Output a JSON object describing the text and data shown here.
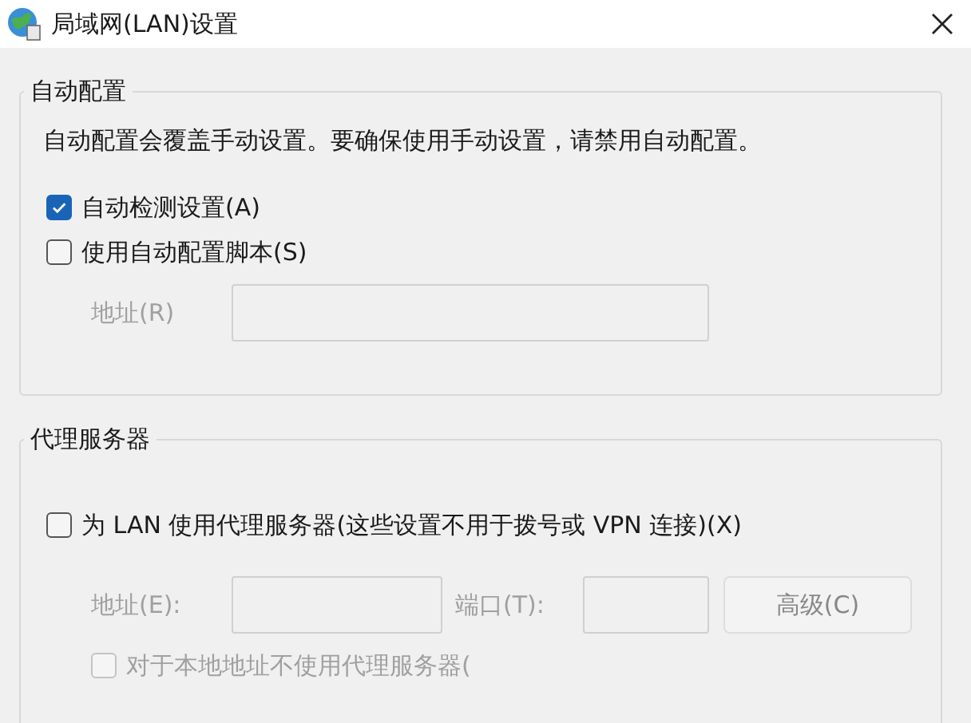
{
  "window": {
    "title": "局域网(LAN)设置"
  },
  "auto_config": {
    "title": "自动配置",
    "description": "自动配置会覆盖手动设置。要确保使用手动设置，请禁用自动配置。",
    "options": [
      {
        "label": "自动检测设置(A)",
        "checked": true,
        "disabled": false
      },
      {
        "label": "使用自动配置脚本(S)",
        "checked": false,
        "disabled": false
      }
    ],
    "address": {
      "label": "地址(R)",
      "disabled": true
    }
  },
  "proxy": {
    "title": "代理服务器",
    "option": {
      "label": "为 LAN 使用代理服务器(这些设置不用于拨号或 VPN 连接)(X)",
      "checked": false,
      "disabled": false
    },
    "address": {
      "label": "地址(E):",
      "disabled": true
    },
    "port": {
      "label": "端口(T):",
      "disabled": true
    },
    "advanced_button": {
      "label": "高级(C)",
      "disabled": true
    },
    "bypass": {
      "label": "对于本地地址不使用代理服务器(",
      "checked": false,
      "disabled": true
    }
  }
}
